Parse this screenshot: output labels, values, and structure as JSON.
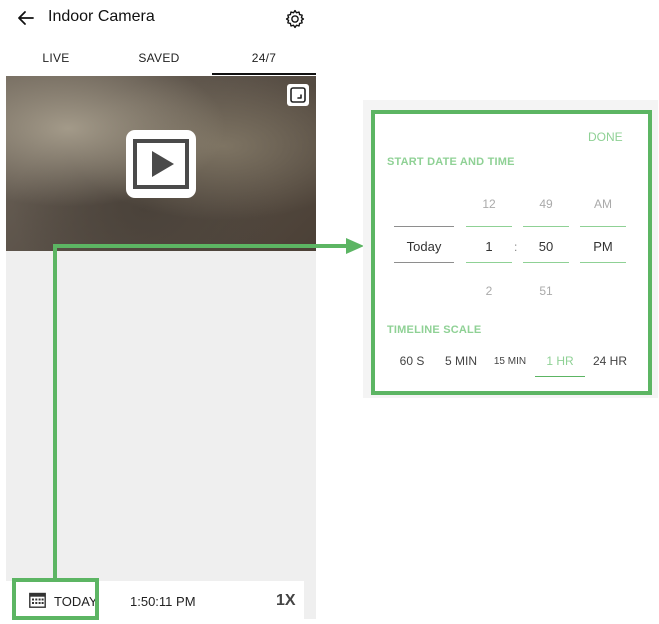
{
  "header": {
    "title": "Indoor Camera"
  },
  "tabs": [
    {
      "label": "LIVE"
    },
    {
      "label": "SAVED"
    },
    {
      "label": "24/7",
      "active": true
    }
  ],
  "bottom_bar": {
    "date_label": "TODAY",
    "time": "1:50:11 PM",
    "speed": "1X"
  },
  "picker": {
    "done_label": "DONE",
    "start_title": "START DATE AND TIME",
    "date": {
      "selected": "Today"
    },
    "hour": {
      "prev": "12",
      "selected": "1",
      "next": "2"
    },
    "separator": ":",
    "minute": {
      "prev": "49",
      "selected": "50",
      "next": "51"
    },
    "ampm": {
      "prev": "AM",
      "selected": "PM"
    },
    "scale_title": "TIMELINE SCALE",
    "scales": [
      "60 S",
      "5 MIN",
      "15 MIN",
      "1 HR",
      "24 HR"
    ],
    "active_scale": "1 HR"
  },
  "colors": {
    "accent_green": "#5cb563",
    "light_green": "#8fd195"
  }
}
